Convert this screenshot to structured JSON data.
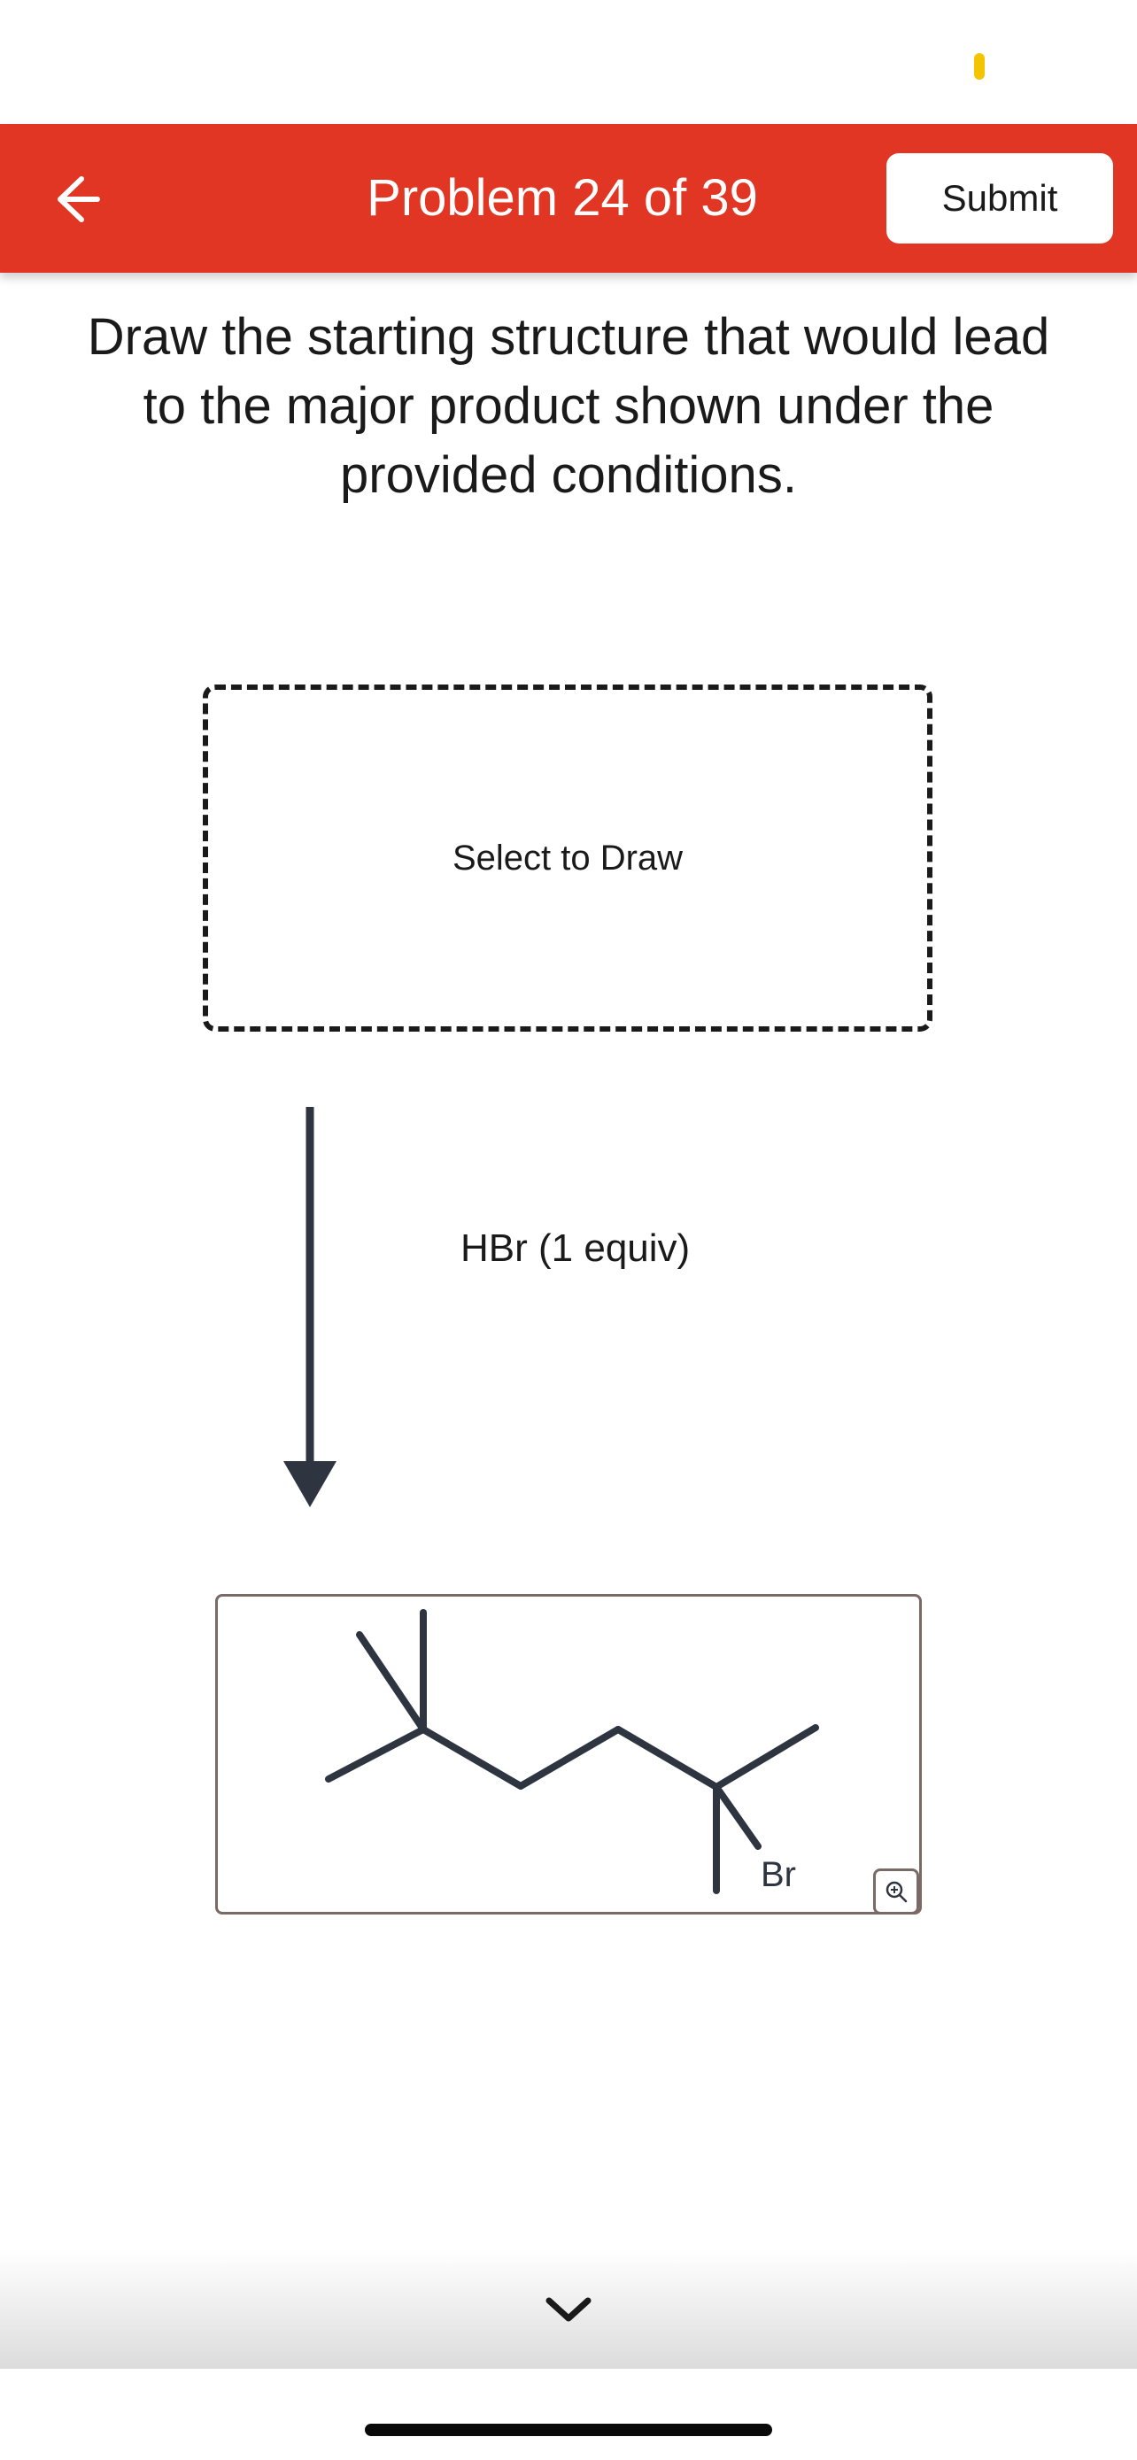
{
  "header": {
    "title": "Problem 24 of 39",
    "submit_label": "Submit",
    "accent_color": "#e03623",
    "back_icon": "arrow-left-icon"
  },
  "instructions": "Draw the starting structure that would lead to the major product shown under the provided conditions.",
  "draw_area": {
    "label": "Select to Draw"
  },
  "reaction": {
    "reagent": "HBr (1 equiv)"
  },
  "product": {
    "atom_labels": [
      "Br"
    ],
    "zoom_icon": "zoom-in-icon"
  },
  "footer": {
    "next_icon": "chevron-down-icon"
  }
}
